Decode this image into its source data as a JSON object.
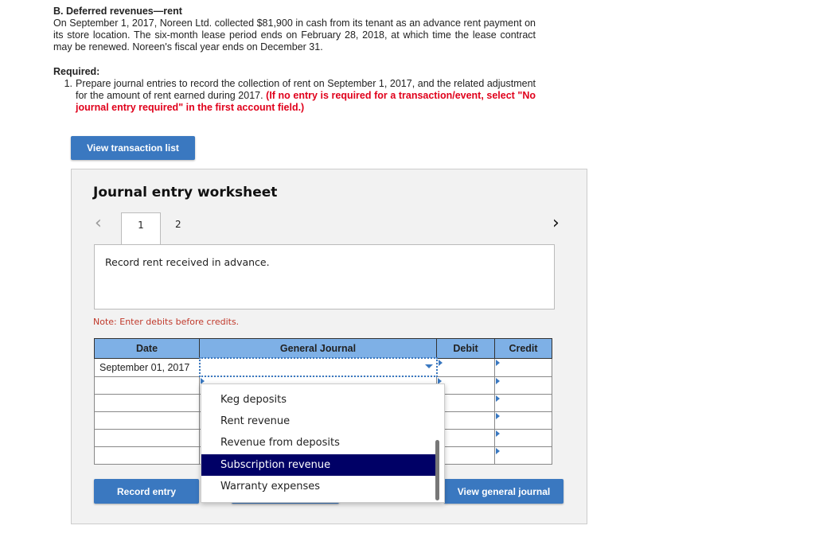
{
  "problem": {
    "title": "B. Deferred revenues—rent",
    "body": "On September 1, 2017, Noreen Ltd. collected $81,900 in cash from its tenant as an advance rent payment on its store location. The six-month lease period ends on February 28, 2018, at which time the lease contract may be renewed. Noreen's fiscal year ends on December 31."
  },
  "required": {
    "label": "Required:",
    "item_number": "1.",
    "item_text": "Prepare journal entries to record the collection of rent on September 1, 2017, and the related adjustment for the amount of rent earned during 2017.",
    "instruction": "(If no entry is required for a transaction/event, select \"No journal entry required\" in the first account field.)"
  },
  "buttons": {
    "view_transaction_list": "View transaction list",
    "record_entry": "Record entry",
    "view_general_journal": "View general journal"
  },
  "worksheet": {
    "title": "Journal entry worksheet",
    "tabs": [
      "1",
      "2"
    ],
    "prev_icon": "chevron-left-icon",
    "next_icon": "chevron-right-icon",
    "description": "Record rent received in advance.",
    "note": "Note: Enter debits before credits."
  },
  "table": {
    "headers": [
      "Date",
      "General Journal",
      "Debit",
      "Credit"
    ],
    "rows": [
      {
        "date": "September 01, 2017",
        "account": "",
        "debit": "",
        "credit": ""
      },
      {
        "date": "",
        "account": "",
        "debit": "",
        "credit": ""
      },
      {
        "date": "",
        "account": "",
        "debit": "",
        "credit": ""
      },
      {
        "date": "",
        "account": "",
        "debit": "",
        "credit": ""
      },
      {
        "date": "",
        "account": "",
        "debit": "",
        "credit": ""
      },
      {
        "date": "",
        "account": "",
        "debit": "",
        "credit": ""
      }
    ]
  },
  "dropdown": {
    "options": [
      "Keg deposits",
      "Rent revenue",
      "Revenue from deposits",
      "Subscription revenue",
      "Warranty expenses"
    ],
    "highlighted": "Subscription revenue"
  },
  "colors": {
    "accent": "#3a78c0",
    "header": "#7eb0e6",
    "highlight": "#000066",
    "instruction": "#e0001b"
  }
}
